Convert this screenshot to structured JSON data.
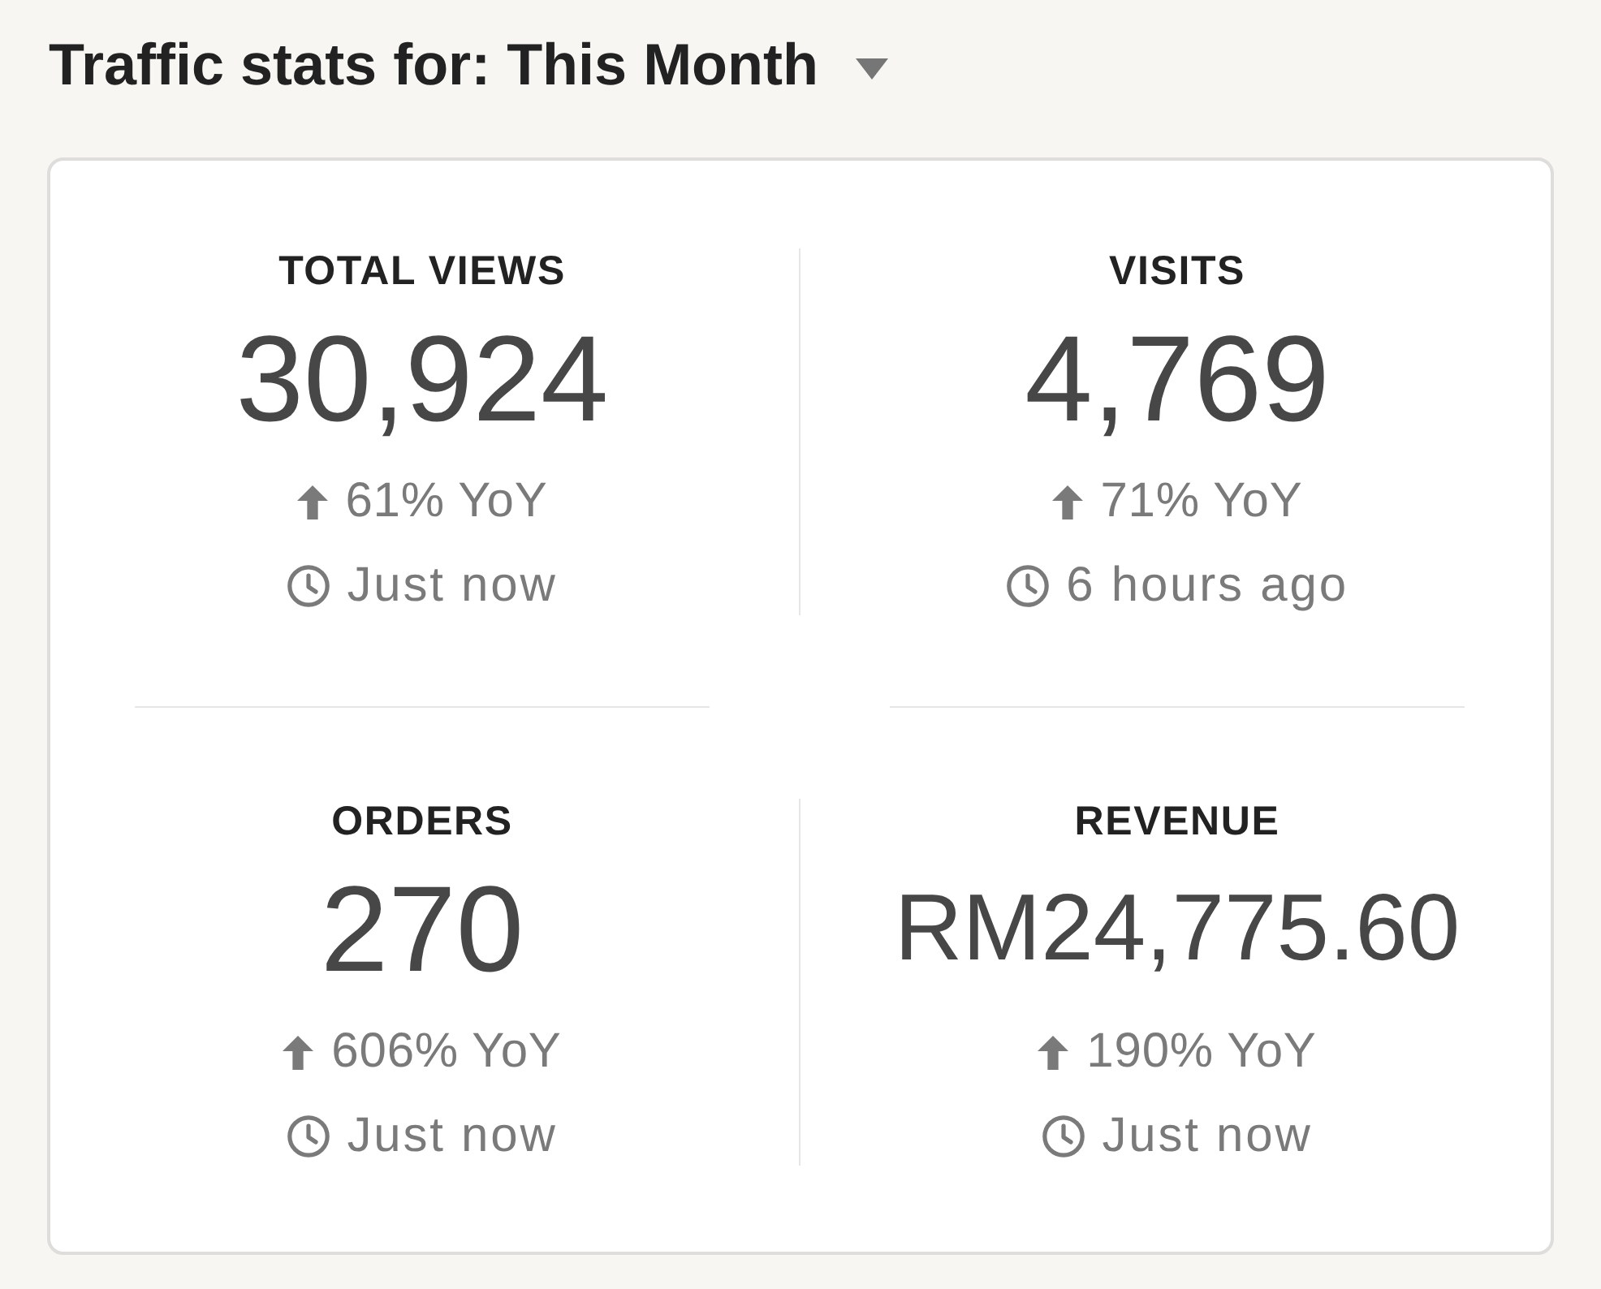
{
  "header": {
    "label": "Traffic stats for:",
    "period": "This Month"
  },
  "stats": [
    {
      "label": "TOTAL VIEWS",
      "value": "30,924",
      "increase": true,
      "change": "61% YoY",
      "updated": "Just now"
    },
    {
      "label": "VISITS",
      "value": "4,769",
      "increase": true,
      "change": "71% YoY",
      "updated": "6 hours ago"
    },
    {
      "label": "ORDERS",
      "value": "270",
      "increase": true,
      "change": "606% YoY",
      "updated": "Just now"
    },
    {
      "label": "REVENUE",
      "value": "RM24,775.60",
      "increase": true,
      "change": "190% YoY",
      "updated": "Just now"
    }
  ]
}
